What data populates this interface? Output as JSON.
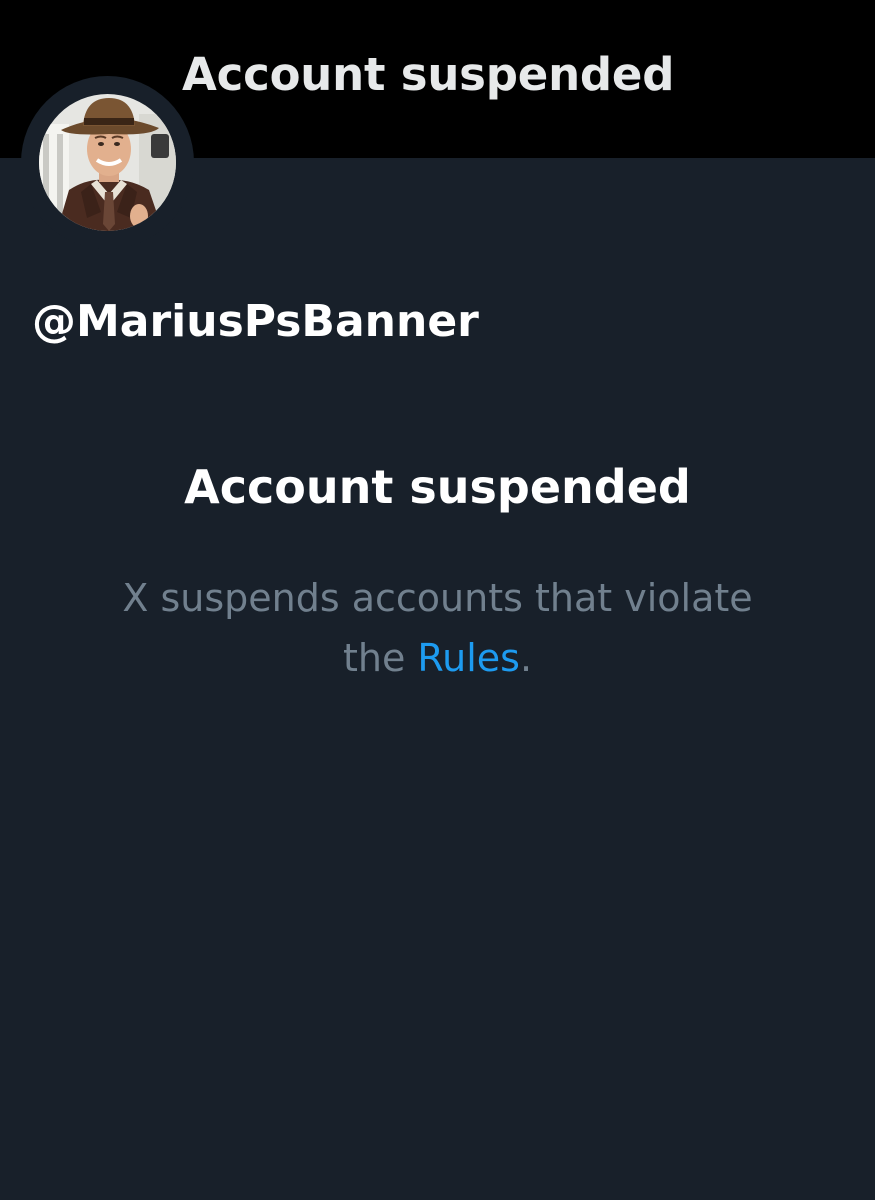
{
  "header": {
    "title": "Account suspended"
  },
  "profile": {
    "handle": "@MariusPsBanner",
    "avatar_icon": "profile-photo-cowboy-hat-man"
  },
  "notice": {
    "heading": "Account suspended",
    "message_line1": "X suspends accounts that violate",
    "message_prefix": "the ",
    "link_label": "Rules",
    "message_suffix": "."
  },
  "colors": {
    "background": "#18202a",
    "header_background": "#000000",
    "secondary_text": "#71808e",
    "link": "#1d9bf0"
  }
}
